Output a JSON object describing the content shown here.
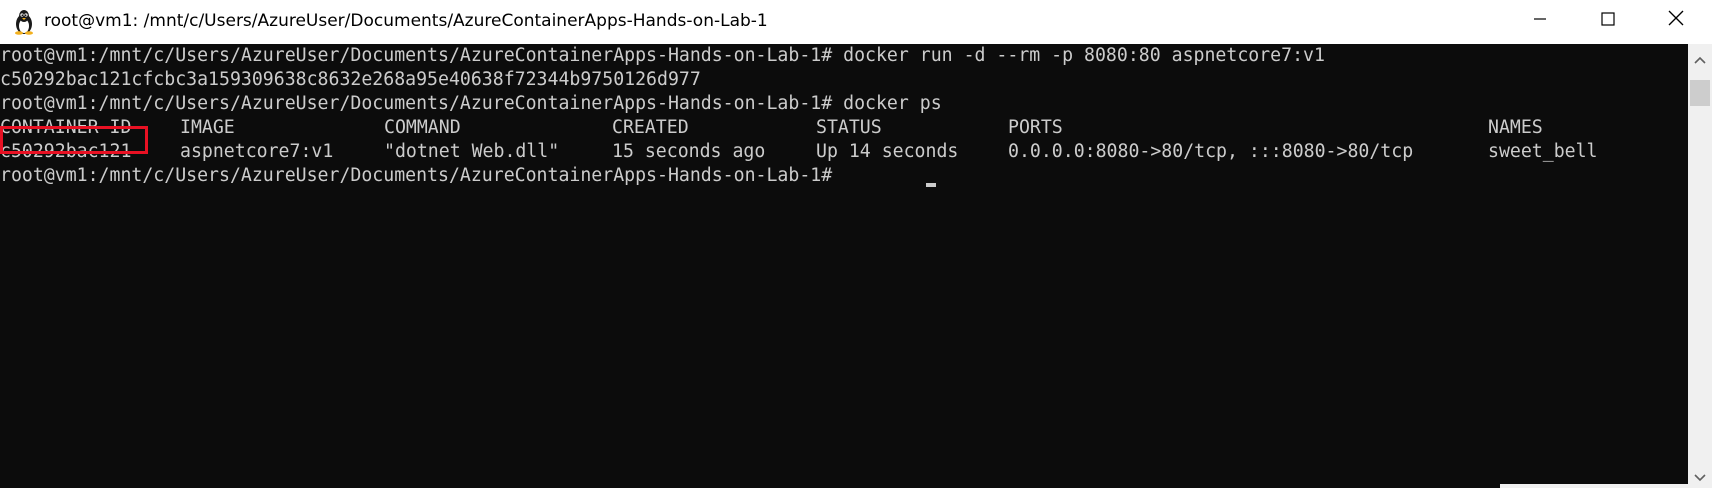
{
  "window": {
    "title": "root@vm1: /mnt/c/Users/AzureUser/Documents/AzureContainerApps-Hands-on-Lab-1",
    "app_icon": "linux-penguin-icon",
    "controls": {
      "minimize": "minimize-icon",
      "maximize": "maximize-icon",
      "close": "close-icon"
    }
  },
  "terminal": {
    "background": "#0c0c0c",
    "foreground": "#cccccc",
    "highlight_color": "#e81123",
    "lines": {
      "l1": "root@vm1:/mnt/c/Users/AzureUser/Documents/AzureContainerApps-Hands-on-Lab-1# docker run -d --rm -p 8080:80 aspnetcore7:v1",
      "l2": "c50292bac121cfcbc3a159309638c8632e268a95e40638f72344b9750126d977",
      "l3": "root@vm1:/mnt/c/Users/AzureUser/Documents/AzureContainerApps-Hands-on-Lab-1# docker ps",
      "l5": "root@vm1:/mnt/c/Users/AzureUser/Documents/AzureContainerApps-Hands-on-Lab-1# "
    },
    "ps_headers": {
      "container_id": "CONTAINER ID",
      "image": "IMAGE",
      "command": "COMMAND",
      "created": "CREATED",
      "status": "STATUS",
      "ports": "PORTS",
      "names": "NAMES"
    },
    "ps_rows": [
      {
        "container_id": "c50292bac121",
        "image": "aspnetcore7:v1",
        "command": "\"dotnet Web.dll\"",
        "created": "15 seconds ago",
        "status": "Up 14 seconds",
        "ports": "0.0.0.0:8080->80/tcp, :::8080->80/tcp",
        "names": "sweet_bell"
      }
    ]
  },
  "scrollbar": {
    "up": "scroll-up-arrow-icon",
    "down": "scroll-down-arrow-icon"
  }
}
